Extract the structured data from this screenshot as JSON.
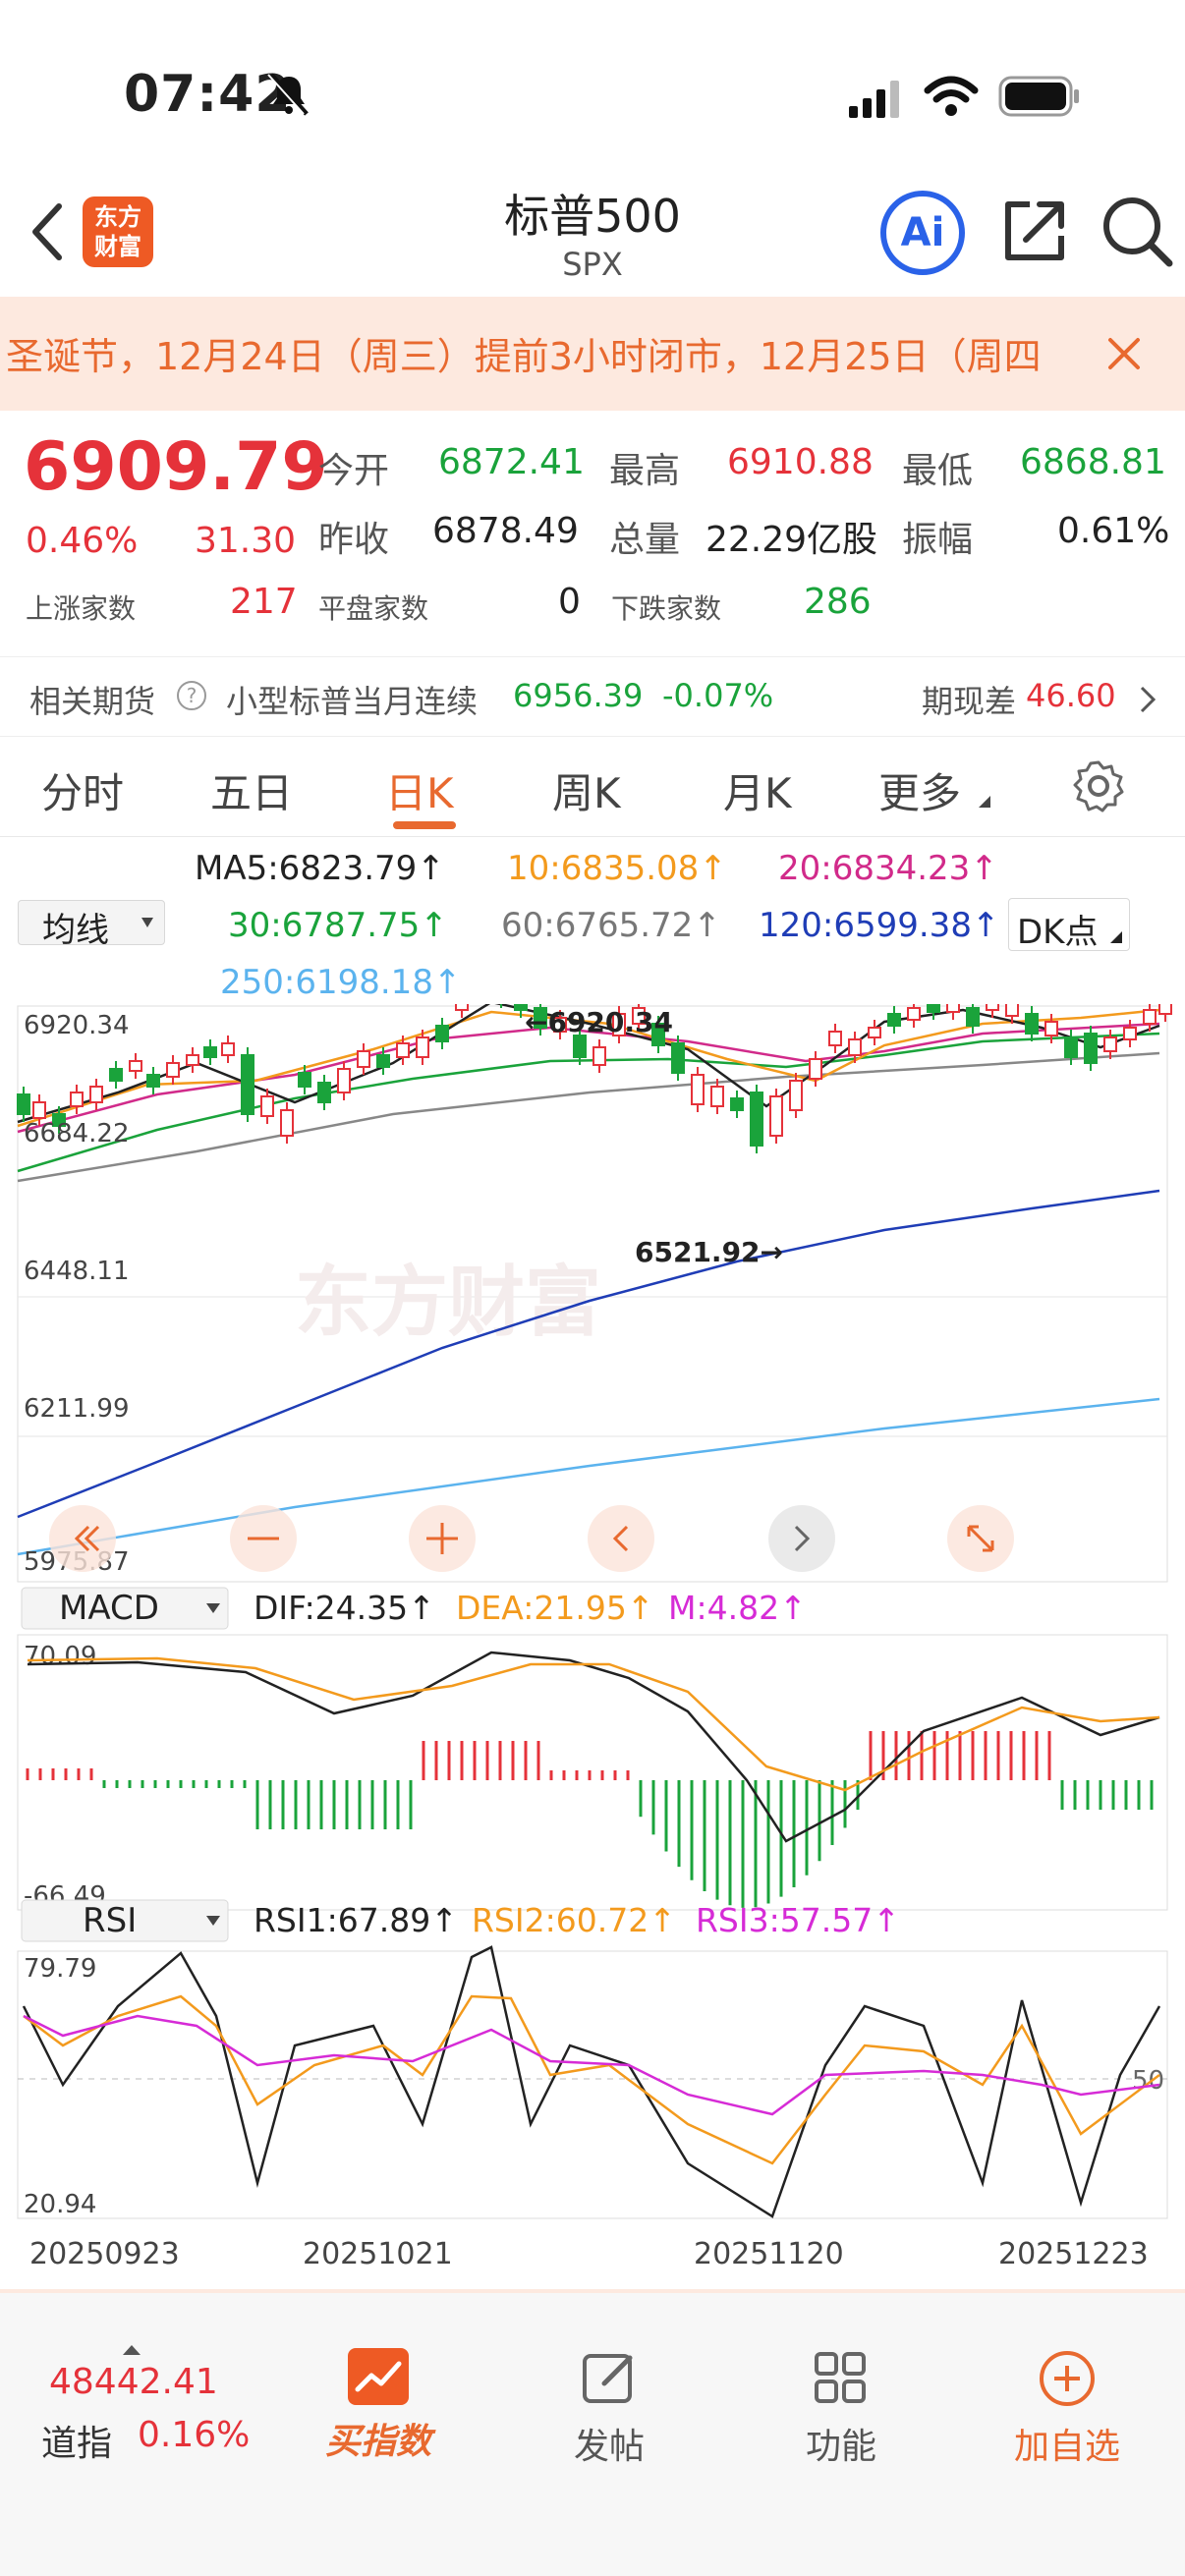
{
  "status_bar": {
    "time": "07:42"
  },
  "header": {
    "title": "标普500",
    "subtitle": "SPX",
    "logo_text": "东方财富",
    "ai_label": "Ai"
  },
  "banner": {
    "text": "圣诞节，12月24日（周三）提前3小时闭市，12月25日（周四"
  },
  "quote": {
    "price": "6909.79",
    "change_pct": "0.46%",
    "change": "31.30",
    "open_label": "今开",
    "open": "6872.41",
    "high_label": "最高",
    "high": "6910.88",
    "low_label": "最低",
    "low": "6868.81",
    "prev_close_label": "昨收",
    "prev_close": "6878.49",
    "volume_label": "总量",
    "volume": "22.29亿股",
    "amplitude_label": "振幅",
    "amplitude": "0.61%",
    "up_label": "上涨家数",
    "up_count": "217",
    "flat_label": "平盘家数",
    "flat_count": "0",
    "down_label": "下跌家数",
    "down_count": "286"
  },
  "futures": {
    "label": "相关期货",
    "name": "小型标普当月连续",
    "value": "6956.39",
    "pct": "-0.07%",
    "basis_label": "期现差",
    "basis": "46.60"
  },
  "tabs": [
    "分时",
    "五日",
    "日K",
    "周K",
    "月K",
    "更多"
  ],
  "active_tab": "日K",
  "ma": {
    "selector": "均线",
    "dk": "DK点",
    "ma5": "MA5:6823.79↑",
    "ma10": "10:6835.08↑",
    "ma20": "20:6834.23↑",
    "ma30": "30:6787.75↑",
    "ma60": "60:6765.72↑",
    "ma120": "120:6599.38↑",
    "ma250": "250:6198.18↑"
  },
  "kline_axis": {
    "y1": "6920.34",
    "y2": "6684.22",
    "y3": "6448.11",
    "y4": "6211.99",
    "y5": "5975.87",
    "high_mark": "6920.34",
    "low_mark": "6521.92"
  },
  "macd": {
    "selector": "MACD",
    "dif": "DIF:24.35↑",
    "dea": "DEA:21.95↑",
    "m": "M:4.82↑",
    "top": "70.09",
    "bottom": "-66.49"
  },
  "rsi": {
    "selector": "RSI",
    "rsi1": "RSI1:67.89↑",
    "rsi2": "RSI2:60.72↑",
    "rsi3": "RSI3:57.57↑",
    "top": "79.79",
    "bottom": "20.94",
    "mid": "50"
  },
  "dates": [
    "20250923",
    "20251021",
    "20251120",
    "20251223"
  ],
  "bottom_bar": {
    "dow_value": "48442.41",
    "dow_label": "道指",
    "dow_pct": "0.16%",
    "buy_index": "买指数",
    "post": "发帖",
    "functions": "功能",
    "add_watch": "加自选"
  },
  "colors": {
    "up": "#e5323a",
    "down": "#1aa33b",
    "accent": "#e8692f"
  }
}
